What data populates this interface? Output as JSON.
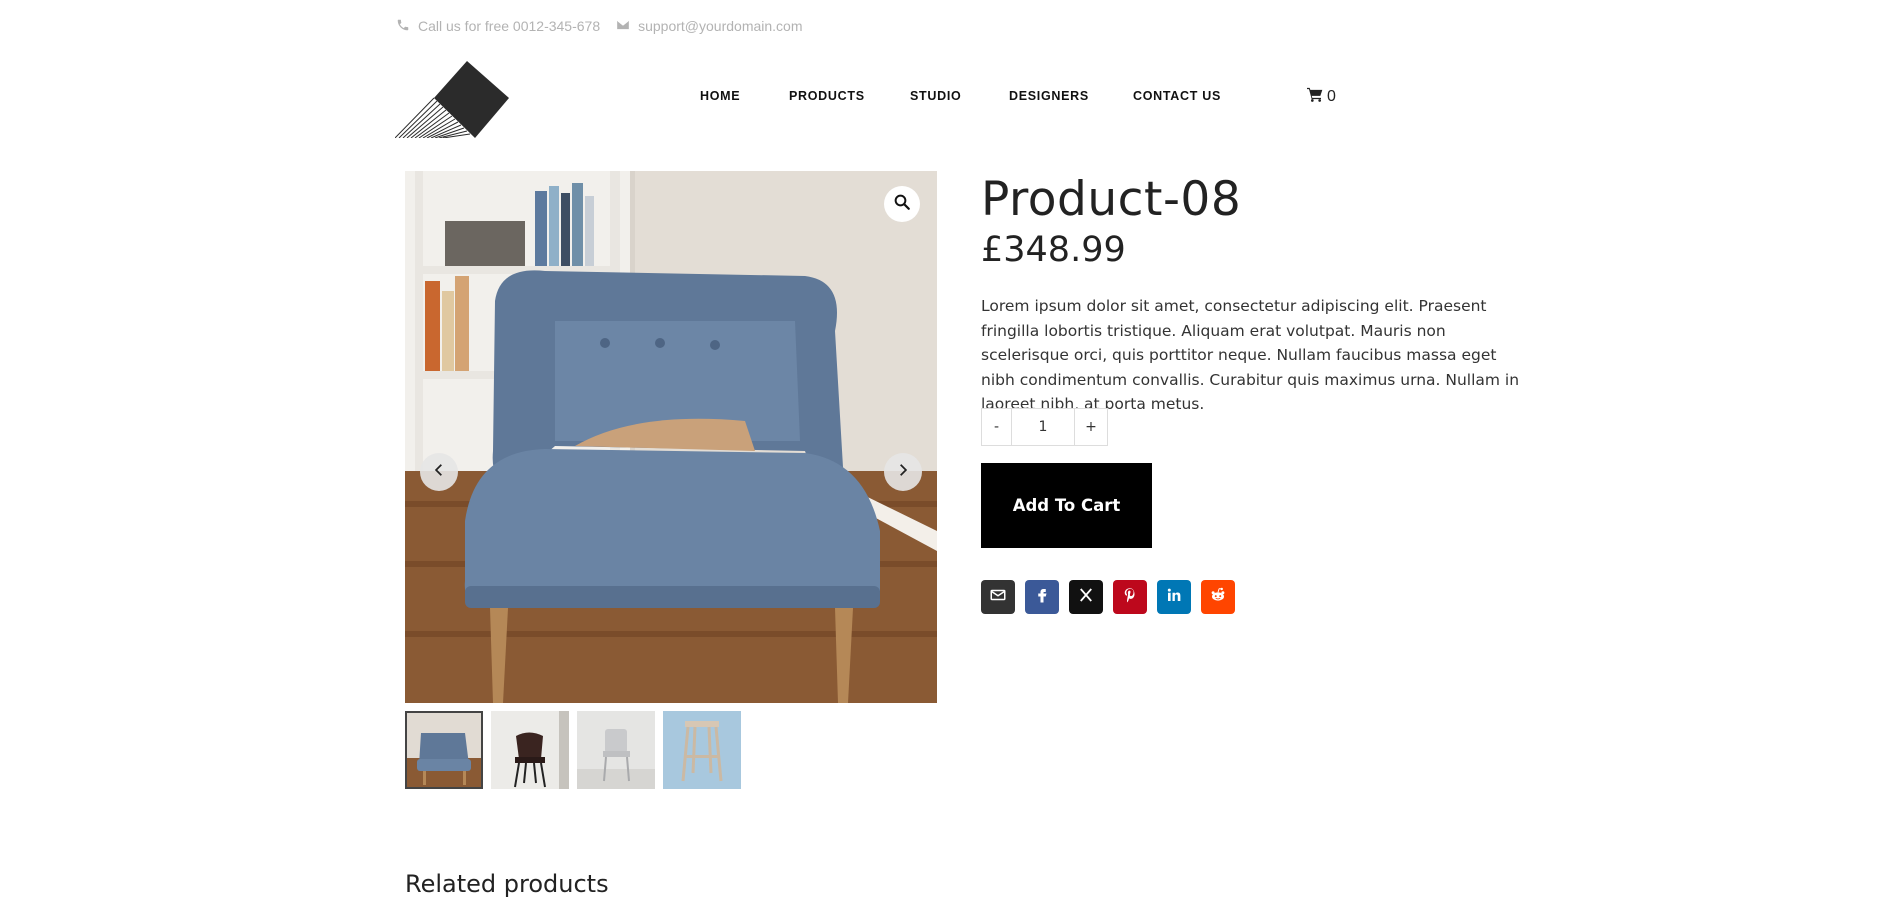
{
  "topbar": {
    "phone_text": "Call us for free 0012-345-678",
    "email_text": "support@yourdomain.com"
  },
  "nav": {
    "items": [
      {
        "label": "HOME"
      },
      {
        "label": "PRODUCTS"
      },
      {
        "label": "STUDIO"
      },
      {
        "label": "DESIGNERS"
      },
      {
        "label": "CONTACT US"
      }
    ]
  },
  "cart": {
    "count": "0"
  },
  "product": {
    "title": "Product-08",
    "price": "£348.99",
    "description": "Lorem ipsum dolor sit amet, consectetur adipiscing elit. Praesent fringilla lobortis tristique. Aliquam erat volutpat. Mauris non scelerisque orci, quis porttitor neque. Nullam faucibus massa eget nibh condimentum convallis. Curabitur quis maximus urna. Nullam in laoreet nibh, at porta metus.",
    "quantity": "1",
    "minus_label": "-",
    "plus_label": "+",
    "add_to_cart_label": "Add To Cart"
  },
  "share": {
    "colors": {
      "email": "#333333",
      "facebook": "#3b5998",
      "x": "#111111",
      "pinterest": "#bd081c",
      "linkedin": "#0077b5",
      "reddit": "#ff4500"
    }
  },
  "related": {
    "heading": "Related products"
  }
}
